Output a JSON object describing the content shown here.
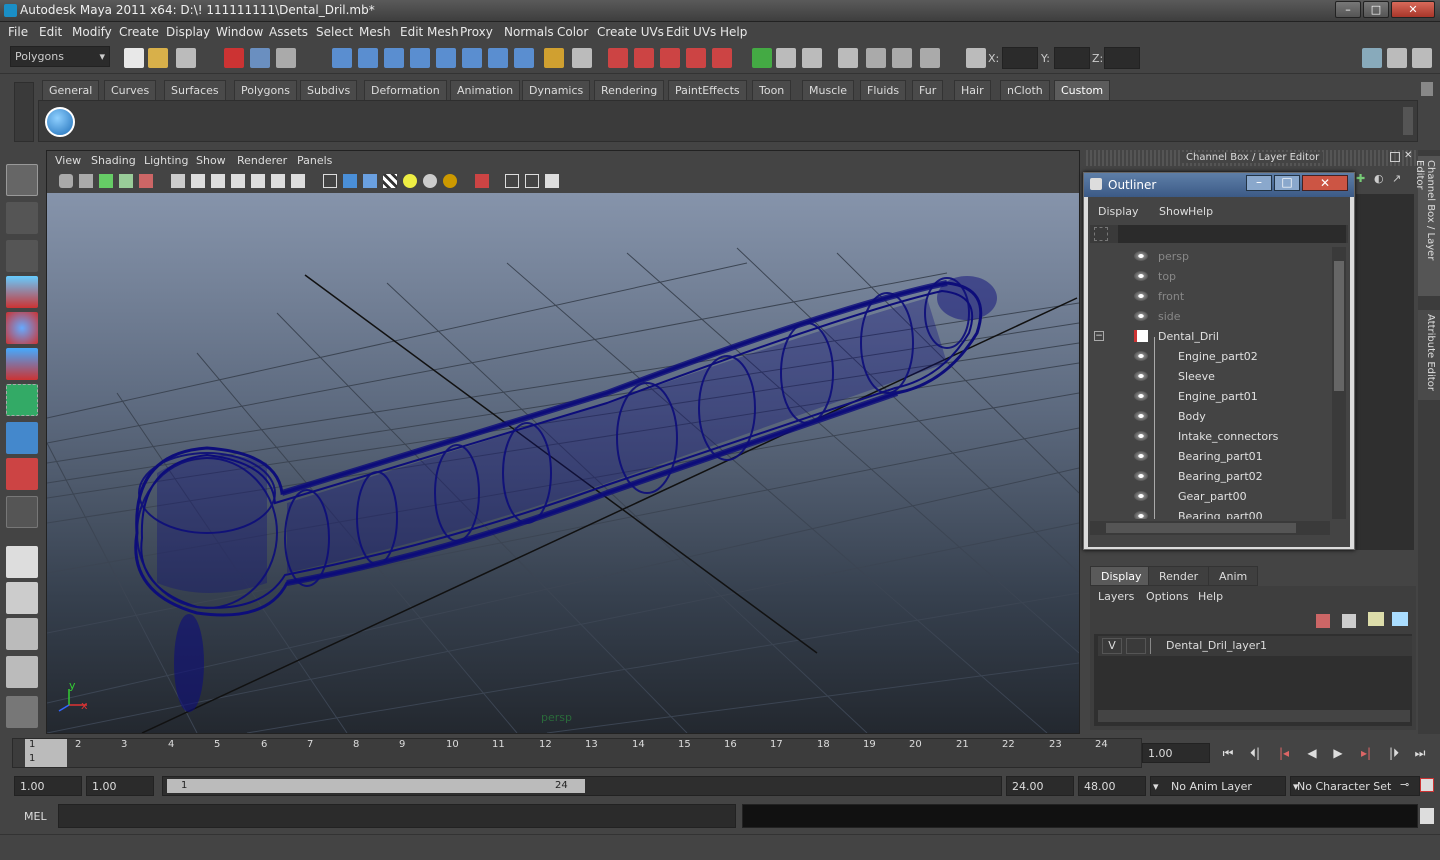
{
  "window": {
    "title": "Autodesk Maya 2011 x64: D:\\! 111111111\\Dental_Dril.mb*"
  },
  "menubar": [
    "File",
    "Edit",
    "Modify",
    "Create",
    "Display",
    "Window",
    "Assets",
    "Select",
    "Mesh",
    "Edit Mesh",
    "Proxy",
    "Normals",
    "Color",
    "Create UVs",
    "Edit UVs",
    "Help"
  ],
  "statusline": {
    "mode": "Polygons",
    "x_label": "X:",
    "y_label": "Y:",
    "z_label": "Z:"
  },
  "shelf_tabs": [
    "General",
    "Curves",
    "Surfaces",
    "Polygons",
    "Subdivs",
    "Deformation",
    "Animation",
    "Dynamics",
    "Rendering",
    "PaintEffects",
    "Toon",
    "Muscle",
    "Fluids",
    "Fur",
    "Hair",
    "nCloth",
    "Custom"
  ],
  "shelf_active": "Custom",
  "viewport": {
    "menu": [
      "View",
      "Shading",
      "Lighting",
      "Show",
      "Renderer",
      "Panels"
    ],
    "camera_label": "persp",
    "axis_y": "y",
    "axis_x": "x",
    "wire_color": "#0d0d7a"
  },
  "channel_box": {
    "title": "Channel Box / Layer Editor",
    "side_tab1": "Channel Box / Layer Editor",
    "side_tab2": "Attribute Editor"
  },
  "outliner": {
    "title": "Outliner",
    "menu": [
      "Display",
      "Show",
      "Help"
    ],
    "items": [
      {
        "label": "persp",
        "type": "camera",
        "dim": true,
        "indent": 0
      },
      {
        "label": "top",
        "type": "camera",
        "dim": true,
        "indent": 0
      },
      {
        "label": "front",
        "type": "camera",
        "dim": true,
        "indent": 0
      },
      {
        "label": "side",
        "type": "camera",
        "dim": true,
        "indent": 0
      },
      {
        "label": "Dental_Dril",
        "type": "group",
        "dim": false,
        "indent": 0
      },
      {
        "label": "Engine_part02",
        "type": "mesh",
        "dim": false,
        "indent": 1
      },
      {
        "label": "Sleeve",
        "type": "mesh",
        "dim": false,
        "indent": 1
      },
      {
        "label": "Engine_part01",
        "type": "mesh",
        "dim": false,
        "indent": 1
      },
      {
        "label": "Body",
        "type": "mesh",
        "dim": false,
        "indent": 1
      },
      {
        "label": "Intake_connectors",
        "type": "mesh",
        "dim": false,
        "indent": 1
      },
      {
        "label": "Bearing_part01",
        "type": "mesh",
        "dim": false,
        "indent": 1
      },
      {
        "label": "Bearing_part02",
        "type": "mesh",
        "dim": false,
        "indent": 1
      },
      {
        "label": "Gear_part00",
        "type": "mesh",
        "dim": false,
        "indent": 1
      },
      {
        "label": "Bearing_part00",
        "type": "mesh",
        "dim": false,
        "indent": 1
      }
    ]
  },
  "layer_editor": {
    "tabs": [
      "Display",
      "Render",
      "Anim"
    ],
    "active_tab": "Display",
    "menu": [
      "Layers",
      "Options",
      "Help"
    ],
    "layers": [
      {
        "visible": "V",
        "name": "Dental_Dril_layer1"
      }
    ]
  },
  "timeline": {
    "ticks": [
      "1",
      "2",
      "3",
      "4",
      "5",
      "6",
      "7",
      "8",
      "9",
      "10",
      "11",
      "12",
      "13",
      "14",
      "15",
      "16",
      "17",
      "18",
      "19",
      "20",
      "21",
      "22",
      "23",
      "24"
    ],
    "current_frame": "1",
    "current_time": "1.00"
  },
  "range": {
    "start_time": "1.00",
    "start_playback": "1.00",
    "slider_start": "1",
    "slider_end": "24",
    "end_playback": "24.00",
    "end_time": "48.00",
    "anim_layer": "No Anim Layer",
    "character_set": "No Character Set"
  },
  "mel": {
    "label": "MEL",
    "command": "",
    "result": ""
  }
}
